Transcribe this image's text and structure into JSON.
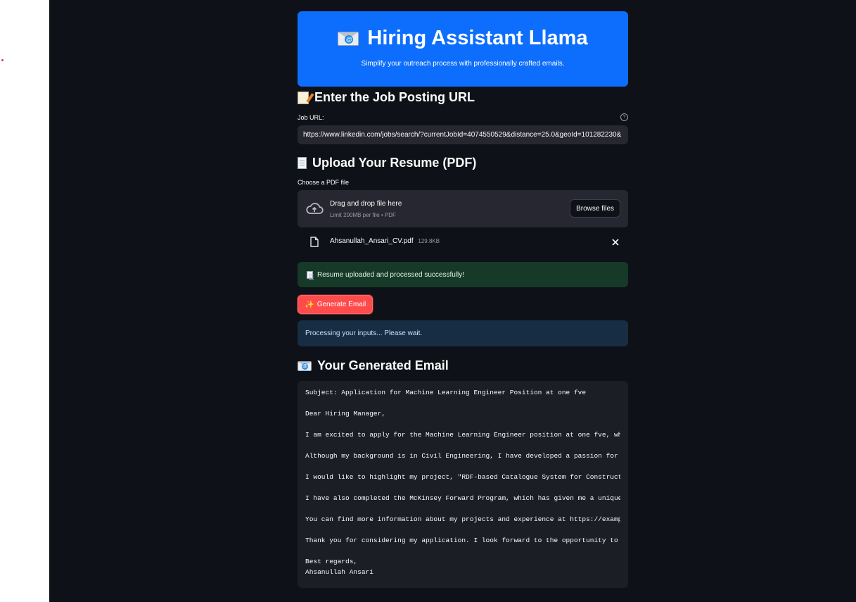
{
  "header": {
    "title": "Hiring Assistant Llama",
    "subtitle": "Simplify your outreach process with professionally crafted emails."
  },
  "job_section": {
    "heading": "Enter the Job Posting URL",
    "label": "Job URL:",
    "help": "?",
    "value": "https://www.linkedin.com/jobs/search/?currentJobId=4074550529&distance=25.0&geoId=101282230&"
  },
  "resume_section": {
    "heading": "Upload Your Resume (PDF)",
    "label": "Choose a PDF file",
    "dropzone_title": "Drag and drop file here",
    "dropzone_limit": "Limit 200MB per file • PDF",
    "browse_label": "Browse files",
    "file_name": "Ahsanullah_Ansari_CV.pdf",
    "file_size": "129.8KB",
    "success_message": "Resume uploaded and processed successfully!"
  },
  "actions": {
    "generate_label": "Generate Email"
  },
  "status": {
    "info": "Processing your inputs... Please wait."
  },
  "email_section": {
    "heading": "Your Generated Email",
    "lines": [
      "Subject: Application for Machine Learning Engineer Position at one fve",
      "",
      "Dear Hiring Manager,",
      "",
      "I am excited to apply for the Machine Learning Engineer position at one fve, where",
      "",
      "Although my background is in Civil Engineering, I have developed a passion for Mac",
      "",
      "I would like to highlight my project, \"RDF-based Catalogue System for Construction",
      "",
      "I have also completed the McKinsey Forward Program, which has given me a unique bl",
      "",
      "You can find more information about my projects and experience at https://example.",
      "",
      "Thank you for considering my application. I look forward to the opportunity to dis",
      "",
      "Best regards,",
      "Ahsanullah Ansari"
    ]
  },
  "colors": {
    "hero": "#0d6efd",
    "background": "#0e1117",
    "primary_button": "#ff4b4b",
    "success_bg": "#173928",
    "info_bg": "#172d43"
  },
  "icons": {
    "title": "envelope-icon",
    "job": "memo-icon",
    "resume": "page-icon",
    "upload": "cloud-upload-icon",
    "file": "file-icon",
    "remove": "close-icon",
    "button": "sparkles-icon",
    "email": "envelope-icon"
  }
}
